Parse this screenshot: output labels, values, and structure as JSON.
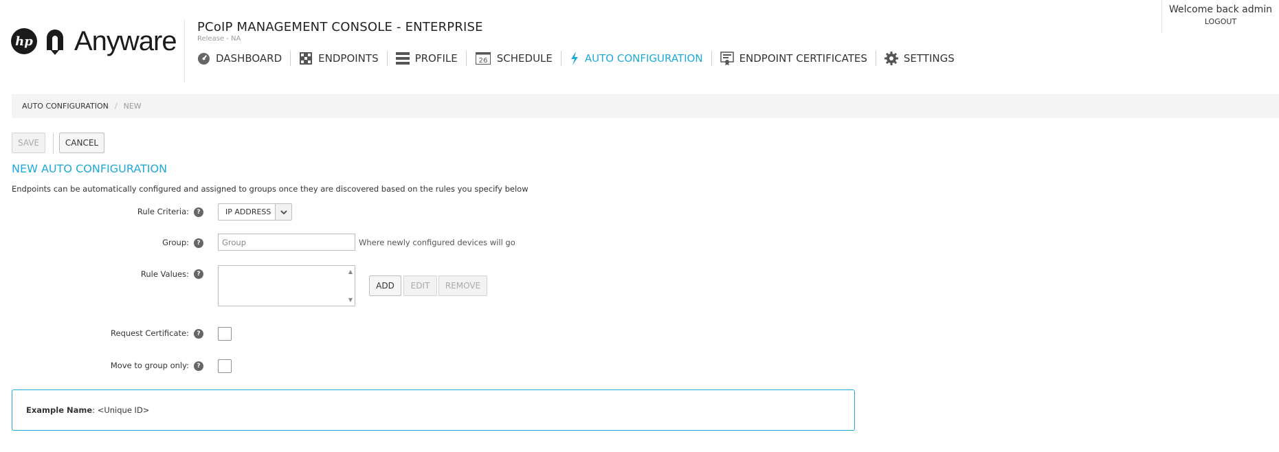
{
  "brand": {
    "hp_text": "hp",
    "product_name": "Anyware",
    "hp_logo_icon": "hp-logo",
    "anyware_logo_icon": "anyware-logo"
  },
  "header": {
    "title": "PCoIP MANAGEMENT CONSOLE - ENTERPRISE",
    "release": "Release - NA",
    "welcome": "Welcome back admin",
    "logout": "LOGOUT"
  },
  "nav": {
    "items": [
      {
        "label": "DASHBOARD",
        "icon": "dashboard-icon",
        "active": false
      },
      {
        "label": "ENDPOINTS",
        "icon": "endpoints-icon",
        "active": false
      },
      {
        "label": "PROFILE",
        "icon": "profile-icon",
        "active": false
      },
      {
        "label": "SCHEDULE",
        "icon": "calendar-icon",
        "active": false,
        "icon_text": "26"
      },
      {
        "label": "AUTO CONFIGURATION",
        "icon": "lightning-icon",
        "active": true
      },
      {
        "label": "ENDPOINT CERTIFICATES",
        "icon": "certificate-icon",
        "active": false
      },
      {
        "label": "SETTINGS",
        "icon": "gear-icon",
        "active": false
      }
    ]
  },
  "breadcrumb": {
    "root": "AUTO CONFIGURATION",
    "separator": "/",
    "current": "NEW"
  },
  "toolbar": {
    "save_label": "SAVE",
    "cancel_label": "CANCEL"
  },
  "page": {
    "title": "NEW AUTO CONFIGURATION",
    "description": "Endpoints can be automatically configured and assigned to groups once they are discovered based on the rules you specify below"
  },
  "form": {
    "rule_criteria": {
      "label": "Rule Criteria:",
      "value": "IP ADDRESS"
    },
    "group": {
      "label": "Group:",
      "placeholder": "Group",
      "value": "",
      "hint": "Where newly configured devices will go"
    },
    "rule_values": {
      "label": "Rule Values:",
      "add": "ADD",
      "edit": "EDIT",
      "remove": "REMOVE"
    },
    "request_certificate": {
      "label": "Request Certificate:",
      "checked": false
    },
    "move_to_group_only": {
      "label": "Move to group only:",
      "checked": false
    },
    "help_glyph": "?"
  },
  "example": {
    "label": "Example Name",
    "colon": ":",
    "value": "<Unique ID>"
  },
  "colors": {
    "accent": "#1fa9d9",
    "text": "#333333",
    "breadcrumb_bg": "#f4f4f4"
  }
}
